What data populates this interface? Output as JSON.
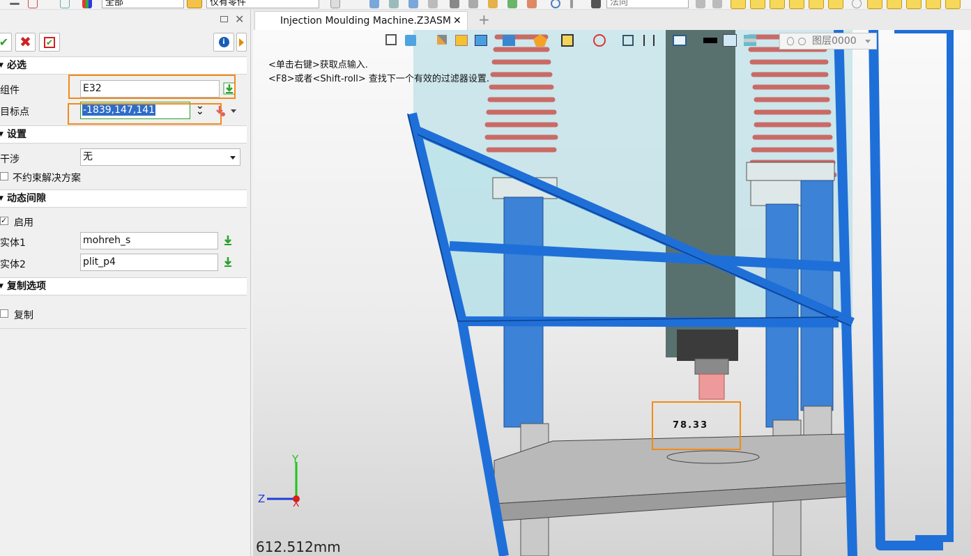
{
  "toolbar": {
    "combo1_value": "全部",
    "combo2_value": "仅有零件",
    "combo3_value": "法向"
  },
  "panel": {
    "actions": {
      "ok_label": "✔",
      "cancel_label": "✖",
      "apply_label": "✔"
    },
    "required": {
      "title": "必选",
      "component_label": "组件",
      "component_value": "E32",
      "target_label": "目标点",
      "target_value": "-1839,147,141"
    },
    "settings": {
      "title": "设置",
      "interference_label": "干涉",
      "interference_value": "无",
      "unconstrained_label": "不约束解决方案"
    },
    "dynamic_gap": {
      "title": "动态间隙",
      "enable_label": "启用",
      "entity1_label": "实体1",
      "entity1_value": "mohreh_s",
      "entity2_label": "实体2",
      "entity2_value": "plit_p4"
    },
    "copy_options": {
      "title": "复制选项",
      "copy_label": "复制"
    }
  },
  "tabs": {
    "active_label": "Injection Moulding  Machine.Z3ASM",
    "close_label": "✕",
    "add_label": "+"
  },
  "viewport": {
    "hint_line1": "<单击右键>获取点输入.",
    "hint_line2": "<F8>或者<Shift-roll> 查找下一个有效的过滤器设置.",
    "layer_label": "图层0000",
    "dimension_value": "78.33",
    "scale_text": "612.512mm",
    "axis_y": "Y",
    "axis_z": "Z",
    "axis_x": "X"
  },
  "colors": {
    "accent_orange": "#f28a1a",
    "frame_blue": "#1f6fd8",
    "spring_red": "#c96a66",
    "glass_cyan": "#a9d8e2"
  }
}
